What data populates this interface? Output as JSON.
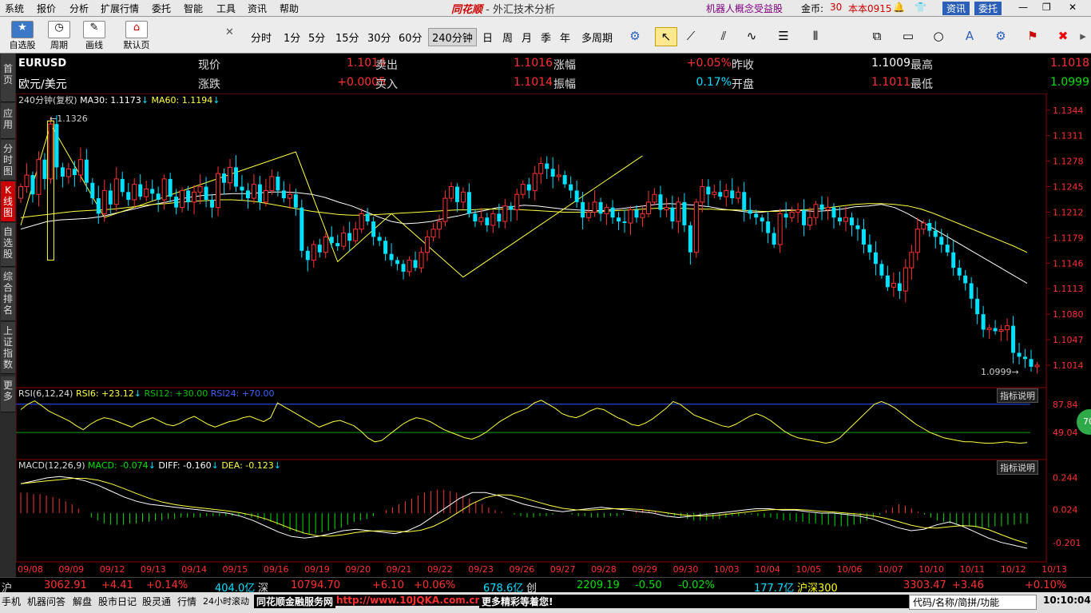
{
  "menu": {
    "items": [
      "系统",
      "报价",
      "分析",
      "扩展行情",
      "委托",
      "智能",
      "工具",
      "资讯",
      "帮助"
    ],
    "app_brand": "同花顺",
    "app_title": "- 外汇技术分析",
    "promo": "机器人概念受益股",
    "coins_label": "金币:",
    "coins_value": "30",
    "version": "本本0915",
    "news_btn": "资讯",
    "trade_btn": "委托"
  },
  "toolbar": {
    "buttons": [
      "自选股",
      "周期",
      "画线",
      "默认页"
    ],
    "periods": [
      "分时",
      "1分",
      "5分",
      "15分",
      "30分",
      "60分",
      "240分钟",
      "日",
      "周",
      "月",
      "季",
      "年",
      "多周期"
    ],
    "selected_period": "240分钟"
  },
  "sidetabs": [
    "首页",
    "应用",
    "分时图",
    "K线图",
    "自选股",
    "综合排名",
    "上证指数",
    "更多"
  ],
  "quote": {
    "symbol": "EURUSD",
    "name": "欧元/美元",
    "fields": [
      {
        "label": "现价",
        "value": "1.1014",
        "color": "#ff3232"
      },
      {
        "label": "卖出",
        "value": "1.1016",
        "color": "#ff3232"
      },
      {
        "label": "涨幅",
        "value": "+0.05%",
        "color": "#ff3232"
      },
      {
        "label": "昨收",
        "value": "1.1009",
        "color": "#ffffff"
      },
      {
        "label": "最高",
        "value": "1.1018",
        "color": "#ff3232"
      },
      {
        "label": "涨跌",
        "value": "+0.0005",
        "color": "#ff3232"
      },
      {
        "label": "买入",
        "value": "1.1014",
        "color": "#ff3232"
      },
      {
        "label": "振幅",
        "value": "0.17%",
        "color": "#00e0ff"
      },
      {
        "label": "开盘",
        "value": "1.1011",
        "color": "#ff3232"
      },
      {
        "label": "最低",
        "value": "1.0999",
        "color": "#00e000"
      }
    ]
  },
  "chart_data": {
    "type": "candlestick",
    "period_label": "240分钟(复权)",
    "ma_label": {
      "ma30": "MA30: 1.1173",
      "ma60": "MA60: 1.1194"
    },
    "price_ticks": [
      "1.1344",
      "1.1311",
      "1.1278",
      "1.1245",
      "1.1212",
      "1.1179",
      "1.1146",
      "1.1113",
      "1.1080",
      "1.1047",
      "1.1014"
    ],
    "ylim": [
      1.0985,
      1.135
    ],
    "high_label": "1.1326",
    "low_label": "1.0999",
    "x_labels": [
      "09/08",
      "09/09",
      "09/12",
      "09/13",
      "09/14",
      "09/15",
      "09/16",
      "09/19",
      "09/20",
      "09/21",
      "09/22",
      "09/23",
      "09/26",
      "09/27",
      "09/28",
      "09/29",
      "09/30",
      "10/03",
      "10/04",
      "10/05",
      "10/06",
      "10/07",
      "10/10",
      "10/11",
      "10/12",
      "10/13"
    ],
    "closes": [
      1.1245,
      1.126,
      1.1235,
      1.128,
      1.1255,
      1.1326,
      1.127,
      1.1258,
      1.1268,
      1.126,
      1.128,
      1.125,
      1.123,
      1.121,
      1.124,
      1.1222,
      1.1255,
      1.1238,
      1.1228,
      1.1248,
      1.1232,
      1.1242,
      1.1236,
      1.1228,
      1.1255,
      1.1232,
      1.1218,
      1.124,
      1.1225,
      1.1238,
      1.1245,
      1.1228,
      1.1218,
      1.1262,
      1.125,
      1.127,
      1.1245,
      1.124,
      1.123,
      1.1248,
      1.1225,
      1.124,
      1.1258,
      1.124,
      1.123,
      1.1235,
      1.1218,
      1.1162,
      1.115,
      1.117,
      1.116,
      1.118,
      1.1172,
      1.1168,
      1.1185,
      1.1175,
      1.119,
      1.121,
      1.12,
      1.118,
      1.1175,
      1.1158,
      1.115,
      1.1145,
      1.1135,
      1.115,
      1.114,
      1.116,
      1.118,
      1.119,
      1.12,
      1.123,
      1.1245,
      1.1225,
      1.1238,
      1.121,
      1.12,
      1.1205,
      1.1195,
      1.121,
      1.12,
      1.122,
      1.1215,
      1.1235,
      1.1248,
      1.124,
      1.1262,
      1.1275,
      1.1268,
      1.1258,
      1.126,
      1.1248,
      1.124,
      1.1225,
      1.1205,
      1.1212,
      1.1225,
      1.121,
      1.1218,
      1.1205,
      1.12,
      1.1198,
      1.1215,
      1.1205,
      1.121,
      1.1225,
      1.1235,
      1.1215,
      1.1218,
      1.12,
      1.1225,
      1.1195,
      1.116,
      1.1225,
      1.1245,
      1.1235,
      1.1238,
      1.1232,
      1.124,
      1.123,
      1.1238,
      1.1215,
      1.121,
      1.1205,
      1.12,
      1.1185,
      1.117,
      1.121,
      1.1205,
      1.1212,
      1.1215,
      1.1195,
      1.1205,
      1.1222,
      1.1215,
      1.1218,
      1.1205,
      1.12,
      1.1205,
      1.1195,
      1.119,
      1.117,
      1.116,
      1.1145,
      1.113,
      1.1115,
      1.112,
      1.111,
      1.114,
      1.116,
      1.119,
      1.1198,
      1.1188,
      1.118,
      1.117,
      1.116,
      1.114,
      1.113,
      1.112,
      1.11,
      1.108,
      1.106,
      1.1062,
      1.1058,
      1.106,
      1.1065,
      1.103,
      1.1025,
      1.1022,
      1.1012,
      1.1014
    ],
    "ma30": [
      1.119,
      1.1195,
      1.12,
      1.1202,
      1.1203,
      1.1204,
      1.1206,
      1.121,
      1.1214,
      1.1218,
      1.1222,
      1.1225,
      1.1229,
      1.1232,
      1.1234,
      1.1235,
      1.1236,
      1.1236,
      1.1237,
      1.1238,
      1.1238,
      1.1237,
      1.1235,
      1.1231,
      1.1225,
      1.122,
      1.1213,
      1.1206,
      1.12,
      1.1197,
      1.1198,
      1.12,
      1.1204,
      1.1207,
      1.1211,
      1.1214,
      1.1218,
      1.1219,
      1.1221,
      1.122,
      1.1218,
      1.1216,
      1.1215,
      1.1214,
      1.1214,
      1.1216,
      1.1218,
      1.122,
      1.1222,
      1.1223,
      1.1222,
      1.1221,
      1.1219,
      1.1216,
      1.1214,
      1.1212,
      1.1212,
      1.1214,
      1.1215,
      1.1214,
      1.1213,
      1.1214,
      1.1216,
      1.1219,
      1.122,
      1.1222,
      1.1218,
      1.121,
      1.12,
      1.119,
      1.118,
      1.117,
      1.116,
      1.115,
      1.114,
      1.113,
      1.112
    ],
    "ma60": [
      1.1205,
      1.1207,
      1.1209,
      1.1211,
      1.1213,
      1.1214,
      1.1215,
      1.1216,
      1.1218,
      1.122,
      1.1222,
      1.1223,
      1.1225,
      1.1226,
      1.1227,
      1.1228,
      1.1228,
      1.1227,
      1.1225,
      1.1222,
      1.1219,
      1.1216,
      1.1213,
      1.1211,
      1.1209,
      1.1208,
      1.1208,
      1.1209,
      1.121,
      1.1211,
      1.1212,
      1.1213,
      1.1214,
      1.1215,
      1.1215,
      1.1216,
      1.1216,
      1.1216,
      1.1215,
      1.1214,
      1.1213,
      1.1212,
      1.1212,
      1.1212,
      1.1213,
      1.1214,
      1.1215,
      1.1216,
      1.1217,
      1.1217,
      1.1217,
      1.1216,
      1.1216,
      1.1215,
      1.1215,
      1.1214,
      1.1213,
      1.1213,
      1.1214,
      1.1215,
      1.1216,
      1.1218,
      1.122,
      1.1222,
      1.1223,
      1.1223,
      1.1222,
      1.122,
      1.1216,
      1.121,
      1.1203,
      1.1196,
      1.1189,
      1.1182,
      1.1175,
      1.1168,
      1.116
    ],
    "zigzag": [
      [
        0,
        1.1195
      ],
      [
        5,
        1.1326
      ],
      [
        14,
        1.1205
      ],
      [
        46,
        1.129
      ],
      [
        53,
        1.1148
      ],
      [
        62,
        1.121
      ],
      [
        74,
        1.1128
      ],
      [
        104,
        1.1285
      ]
    ]
  },
  "rsi": {
    "label": "RSI(6,12,24)",
    "rsi6": "RSI6: +23.12",
    "rsi12": "RSI12: +30.00",
    "rsi24": "RSI24: +70.00",
    "ticks": [
      "87.84",
      "49.04"
    ],
    "explain": "指标说明",
    "badge": "70",
    "values": [
      72,
      80,
      85,
      78,
      70,
      65,
      60,
      55,
      48,
      42,
      50,
      56,
      60,
      58,
      54,
      50,
      46,
      52,
      56,
      60,
      55,
      50,
      48,
      52,
      58,
      62,
      56,
      50,
      46,
      50,
      54,
      56,
      60,
      62,
      58,
      54,
      60,
      82,
      76,
      70,
      64,
      58,
      52,
      46,
      50,
      54,
      56,
      52,
      48,
      40,
      30,
      24,
      26,
      34,
      42,
      50,
      56,
      60,
      58,
      54,
      48,
      42,
      38,
      34,
      30,
      28,
      32,
      38,
      46,
      54,
      60,
      66,
      70,
      74,
      82,
      86,
      80,
      74,
      66,
      62,
      60,
      64,
      70,
      74,
      72,
      66,
      60,
      56,
      50,
      48,
      52,
      58,
      66,
      74,
      84,
      80,
      72,
      64,
      60,
      56,
      52,
      48,
      46,
      50,
      56,
      62,
      66,
      62,
      56,
      48,
      40,
      34,
      30,
      28,
      26,
      24,
      22,
      24,
      30,
      40,
      50,
      60,
      70,
      80,
      84,
      80,
      74,
      66,
      58,
      50,
      44,
      38,
      34,
      30,
      28,
      26,
      24,
      24,
      23,
      22,
      22,
      23,
      24,
      23,
      22,
      23
    ]
  },
  "macd": {
    "label": "MACD(12,26,9)",
    "macd": "MACD: -0.074",
    "diff": "DIFF: -0.160",
    "dea": "DEA: -0.123",
    "ticks": [
      "0.244",
      "0.024",
      "-0.201"
    ],
    "explain": "指标说明",
    "hist": [
      0.14,
      0.14,
      0.13,
      0.13,
      0.12,
      0.11,
      0.1,
      0.08,
      0.06,
      0.03,
      0.0,
      -0.03,
      -0.05,
      -0.07,
      -0.08,
      -0.08,
      -0.08,
      -0.07,
      -0.07,
      -0.06,
      -0.06,
      -0.05,
      -0.05,
      -0.04,
      -0.04,
      -0.03,
      -0.03,
      -0.03,
      -0.03,
      -0.02,
      -0.02,
      -0.02,
      -0.02,
      -0.02,
      -0.02,
      -0.02,
      -0.03,
      -0.04,
      -0.05,
      -0.06,
      -0.08,
      -0.1,
      -0.12,
      -0.13,
      -0.14,
      -0.14,
      -0.14,
      -0.13,
      -0.12,
      -0.11,
      -0.1,
      -0.08,
      -0.06,
      -0.05,
      -0.04,
      -0.02,
      0.0,
      0.02,
      0.04,
      0.06,
      0.08,
      0.1,
      0.12,
      0.14,
      0.15,
      0.16,
      0.16,
      0.15,
      0.14,
      0.12,
      0.1,
      0.08,
      0.06,
      0.04,
      0.02,
      0.01,
      0.0,
      -0.01,
      -0.02,
      -0.03,
      -0.03,
      -0.02,
      -0.02,
      -0.01,
      0.0,
      0.0,
      -0.01,
      -0.02,
      -0.02,
      -0.03,
      -0.03,
      -0.03,
      -0.02,
      -0.02,
      -0.01,
      0.0,
      0.01,
      0.02,
      0.02,
      0.01,
      0.0,
      -0.01,
      -0.02,
      -0.03,
      -0.04,
      -0.05,
      -0.05,
      -0.05,
      -0.04,
      -0.04,
      -0.03,
      -0.02,
      -0.02,
      -0.01,
      -0.01,
      -0.02,
      -0.03,
      -0.03,
      -0.04,
      -0.05,
      -0.05,
      -0.06,
      -0.06,
      -0.07,
      -0.07,
      -0.08,
      -0.08,
      -0.09,
      -0.09,
      -0.09,
      -0.08,
      -0.07,
      -0.05,
      -0.03,
      -0.01,
      0.02,
      0.04,
      0.06,
      0.05,
      0.03,
      0.01,
      -0.01,
      -0.03,
      -0.05,
      -0.06,
      -0.07,
      -0.08,
      -0.09,
      -0.09,
      -0.1,
      -0.1,
      -0.1,
      -0.09,
      -0.09,
      -0.08,
      -0.08,
      -0.07,
      -0.07
    ],
    "diff_series": [
      0.2,
      0.22,
      0.24,
      0.25,
      0.24,
      0.22,
      0.19,
      0.15,
      0.11,
      0.08,
      0.06,
      0.05,
      0.04,
      0.03,
      0.02,
      0.01,
      0.0,
      -0.02,
      -0.05,
      -0.09,
      -0.13,
      -0.16,
      -0.17,
      -0.16,
      -0.14,
      -0.12,
      -0.11,
      -0.12,
      -0.13,
      -0.14,
      -0.12,
      -0.08,
      -0.02,
      0.04,
      0.1,
      0.14,
      0.14,
      0.12,
      0.09,
      0.06,
      0.04,
      0.02,
      0.01,
      0.02,
      0.03,
      0.04,
      0.03,
      0.02,
      0.01,
      0.0,
      -0.02,
      -0.03,
      -0.02,
      -0.01,
      0.0,
      0.01,
      0.02,
      0.03,
      0.03,
      0.02,
      0.02,
      0.01,
      0.0,
      0.0,
      -0.01,
      -0.02,
      -0.04,
      -0.07,
      -0.1,
      -0.12,
      -0.11,
      -0.08,
      -0.06,
      -0.09,
      -0.13,
      -0.17,
      -0.2,
      -0.22,
      -0.24
    ]
  },
  "index_bar": [
    {
      "text": "沪",
      "color": "#ddd"
    },
    {
      "text": "3062.91",
      "color": "#ff3232"
    },
    {
      "text": "+4.41",
      "color": "#ff3232"
    },
    {
      "text": "+0.14%",
      "color": "#ff3232"
    },
    {
      "text": "404.0亿",
      "color": "#00e0ff"
    },
    {
      "text": "深",
      "color": "#ddd"
    },
    {
      "text": "10794.70",
      "color": "#ff3232"
    },
    {
      "text": "+6.10",
      "color": "#ff3232"
    },
    {
      "text": "+0.06%",
      "color": "#ff3232"
    },
    {
      "text": "678.6亿",
      "color": "#00e0ff"
    },
    {
      "text": "创",
      "color": "#ddd"
    },
    {
      "text": "2209.19",
      "color": "#00e000"
    },
    {
      "text": "-0.50",
      "color": "#00e000"
    },
    {
      "text": "-0.02%",
      "color": "#00e000"
    },
    {
      "text": "177.7亿",
      "color": "#00e0ff"
    },
    {
      "text": "沪深300",
      "color": "#ffff00"
    },
    {
      "text": "3303.47",
      "color": "#ff3232"
    },
    {
      "text": "+3.46",
      "color": "#ff3232"
    },
    {
      "text": "+0.10%",
      "color": "#ff3232"
    }
  ],
  "bottom_bar": {
    "items": [
      "手机",
      "机器问答",
      "解盘",
      "股市日记",
      "股灵通",
      "行情",
      "24小时滚动"
    ],
    "brand": "同花顺金融服务网",
    "url": "http://www.10JQKA.com.cn",
    "slogan": "更多精彩等着您!",
    "search": "代码/名称/简拼/功能",
    "clock": "10:10:04"
  }
}
